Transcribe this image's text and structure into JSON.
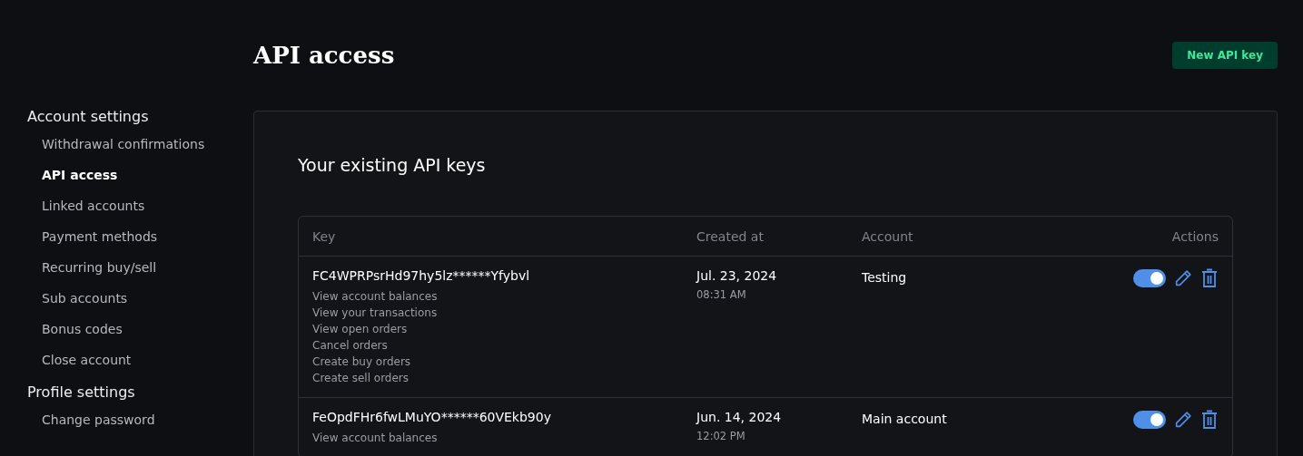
{
  "sidebar": {
    "sections": [
      {
        "title": "Account settings",
        "items": [
          {
            "label": "Withdrawal confirmations",
            "selected": false
          },
          {
            "label": "API access",
            "selected": true
          },
          {
            "label": "Linked accounts",
            "selected": false
          },
          {
            "label": "Payment methods",
            "selected": false
          },
          {
            "label": "Recurring buy/sell",
            "selected": false
          },
          {
            "label": "Sub accounts",
            "selected": false
          },
          {
            "label": "Bonus codes",
            "selected": false
          },
          {
            "label": "Close account",
            "selected": false
          }
        ]
      },
      {
        "title": "Profile settings",
        "items": [
          {
            "label": "Change password",
            "selected": false
          }
        ]
      }
    ]
  },
  "page_title": "API access",
  "new_key_button": "New API key",
  "card_title": "Your existing API keys",
  "table": {
    "columns": [
      "Key",
      "Created at",
      "Account",
      "Actions"
    ],
    "rows": [
      {
        "key": "FC4WPRPsrHd97hy5lz******Yfybvl",
        "permissions": [
          "View account balances",
          "View your transactions",
          "View open orders",
          "Cancel orders",
          "Create buy orders",
          "Create sell orders"
        ],
        "date": "Jul. 23, 2024",
        "time": "08:31 AM",
        "account": "Testing",
        "on": true
      },
      {
        "key": "FeOpdFHr6fwLMuYO******60VEkb90y",
        "permissions": [
          "View account balances"
        ],
        "date": "Jun. 14, 2024",
        "time": "12:02 PM",
        "account": "Main account",
        "on": true
      }
    ]
  }
}
